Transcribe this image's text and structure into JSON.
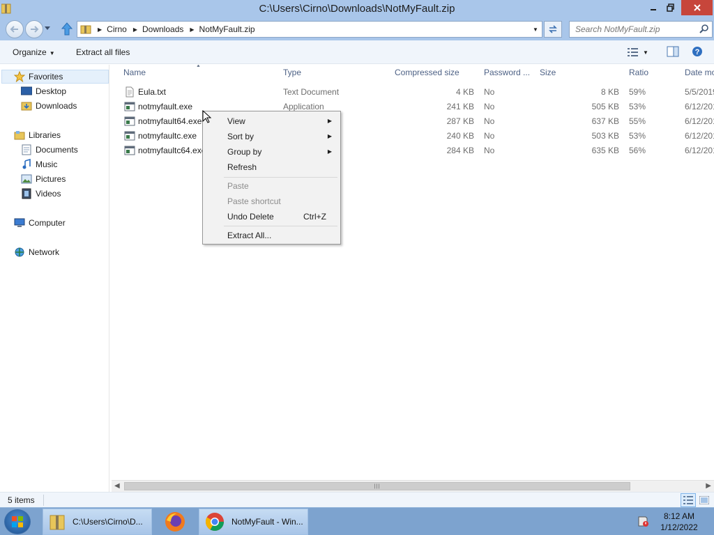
{
  "window": {
    "title": "C:\\Users\\Cirno\\Downloads\\NotMyFault.zip"
  },
  "address": {
    "crumbs": [
      "Cirno",
      "Downloads",
      "NotMyFault.zip"
    ],
    "search_placeholder": "Search NotMyFault.zip"
  },
  "commandbar": {
    "organize": "Organize",
    "extract_all": "Extract all files"
  },
  "navpane": {
    "favorites": "Favorites",
    "desktop": "Desktop",
    "downloads": "Downloads",
    "libraries": "Libraries",
    "documents": "Documents",
    "music": "Music",
    "pictures": "Pictures",
    "videos": "Videos",
    "computer": "Computer",
    "network": "Network"
  },
  "columns": {
    "name": "Name",
    "type": "Type",
    "compressed": "Compressed size",
    "password": "Password ...",
    "size": "Size",
    "ratio": "Ratio",
    "date": "Date mo"
  },
  "files": [
    {
      "name": "Eula.txt",
      "type": "Text Document",
      "compressed": "4 KB",
      "password": "No",
      "size": "8 KB",
      "ratio": "59%",
      "date": "5/5/2019"
    },
    {
      "name": "notmyfault.exe",
      "type": "Application",
      "compressed": "241 KB",
      "password": "No",
      "size": "505 KB",
      "ratio": "53%",
      "date": "6/12/201"
    },
    {
      "name": "notmyfault64.exe",
      "type": "",
      "compressed": "287 KB",
      "password": "No",
      "size": "637 KB",
      "ratio": "55%",
      "date": "6/12/201"
    },
    {
      "name": "notmyfaultc.exe",
      "type": "",
      "compressed": "240 KB",
      "password": "No",
      "size": "503 KB",
      "ratio": "53%",
      "date": "6/12/201"
    },
    {
      "name": "notmyfaultc64.exe",
      "type": "",
      "compressed": "284 KB",
      "password": "No",
      "size": "635 KB",
      "ratio": "56%",
      "date": "6/12/201"
    }
  ],
  "context_menu": {
    "view": "View",
    "sort_by": "Sort by",
    "group_by": "Group by",
    "refresh": "Refresh",
    "paste": "Paste",
    "paste_shortcut": "Paste shortcut",
    "undo_delete": "Undo Delete",
    "undo_shortcut": "Ctrl+Z",
    "extract_all": "Extract All..."
  },
  "statusbar": {
    "count": "5 items"
  },
  "taskbar": {
    "explorer_label": "C:\\Users\\Cirno\\D...",
    "chrome_label": "NotMyFault - Win...",
    "time": "8:12 AM",
    "date": "1/12/2022"
  },
  "colors": {
    "titlebar": "#a9c6ea",
    "close_button": "#c7463b",
    "taskbar": "#7da3cf",
    "header_text": "#4d6185"
  },
  "icons": [
    "zip-folder-icon",
    "back-arrow-icon",
    "forward-arrow-icon",
    "up-arrow-icon",
    "refresh-icon",
    "search-icon",
    "views-icon",
    "preview-pane-icon",
    "help-icon",
    "star-icon",
    "desktop-icon",
    "downloads-folder-icon",
    "libraries-icon",
    "documents-icon",
    "music-icon",
    "pictures-icon",
    "videos-icon",
    "computer-icon",
    "network-icon",
    "text-file-icon",
    "application-icon",
    "windows-logo-icon",
    "firefox-icon",
    "chrome-icon",
    "action-center-icon"
  ]
}
